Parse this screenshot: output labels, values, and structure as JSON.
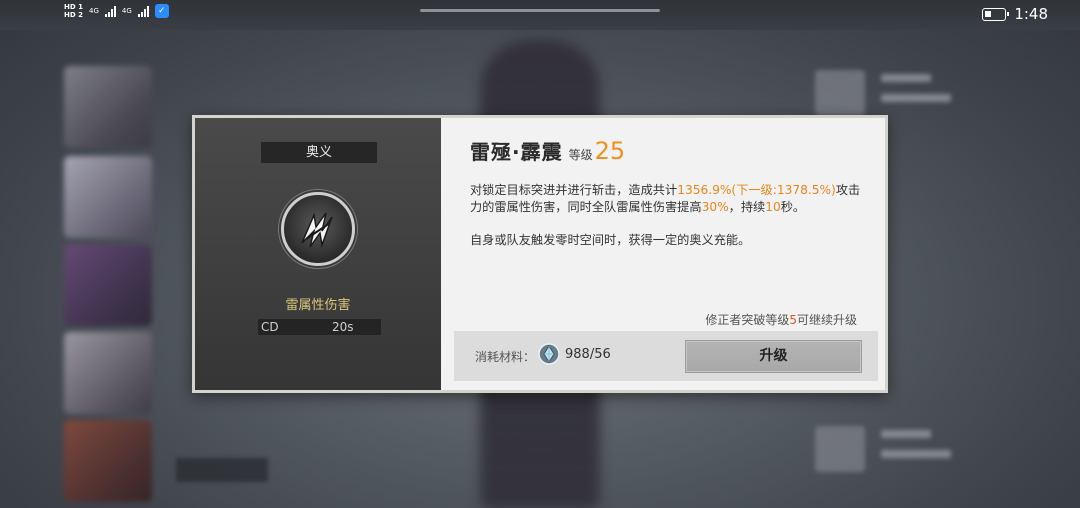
{
  "status_bar": {
    "hd1": "HD 1",
    "hd2": "HD 2",
    "net1": "4G",
    "net2": "4G",
    "time": "1:48"
  },
  "skill_dialog": {
    "category_tag": "奥义",
    "damage_type": "雷属性伤害",
    "cd_label": "CD",
    "cd_value": "20s",
    "skill_name": "雷殛·霹震",
    "level_label": "等级",
    "level_value": "25",
    "description": {
      "part1": "对锁定目标突进并进行斩击，造成共计",
      "pct": "1356.9%(下一级:1378.5%)",
      "part2": "攻击力的雷属性伤害，同时全队雷属性伤害提高",
      "boost": "30%",
      "part3": "，持续",
      "duration": "10",
      "part4": "秒。"
    },
    "description_2": "自身或队友触发零时空间时，获得一定的奥义充能。",
    "breakthrough_note": {
      "prefix": "修正者突破等级",
      "level": "5",
      "suffix": "可继续升级"
    },
    "material_label": "消耗材料：",
    "material_count": "988/56",
    "upgrade_button": "升级"
  },
  "colors": {
    "accent_orange": "#f0901f",
    "damage_gold": "#d9c97a"
  }
}
